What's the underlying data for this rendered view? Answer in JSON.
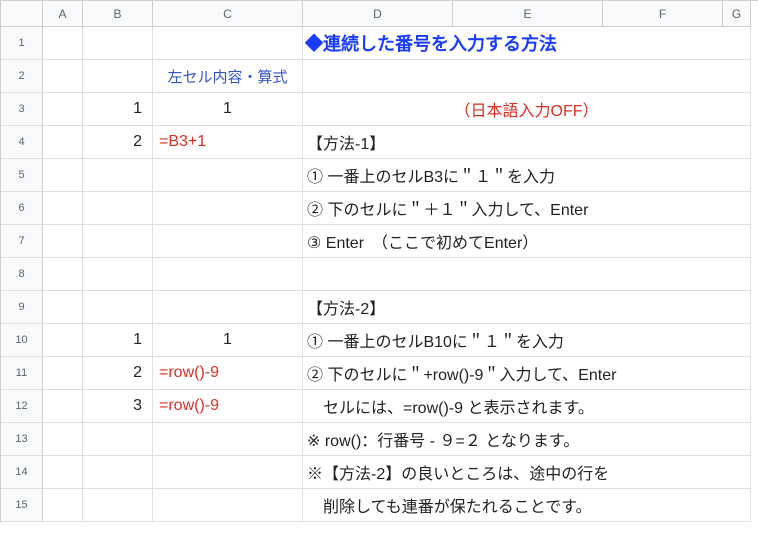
{
  "columns": {
    "A": "A",
    "B": "B",
    "C": "C",
    "D": "D",
    "E": "E",
    "F": "F",
    "G": "G"
  },
  "rows": [
    "1",
    "2",
    "3",
    "4",
    "5",
    "6",
    "7",
    "8",
    "9",
    "10",
    "11",
    "12",
    "13",
    "14",
    "15"
  ],
  "title": "◆連続した番号を入力する方法",
  "c2": "左セル内容・算式",
  "b3": "1",
  "c3": "1",
  "d3": "（日本語入力OFF）",
  "b4": "2",
  "c4": "=B3+1",
  "d4": "【方法-1】",
  "d5": "① 一番上のセルB3に＂１＂を入力",
  "d6": "② 下のセルに＂＋１＂入力して、Enter",
  "d7": "③ Enter　（ここで初めてEnter）",
  "d9": "【方法-2】",
  "b10": "1",
  "c10": "1",
  "d10": "① 一番上のセルB10に＂１＂を入力",
  "b11": "2",
  "c11": "=row()-9",
  "d11": "② 下のセルに＂+row()-9＂入力して、Enter",
  "b12": "3",
  "c12": "=row()-9",
  "d12": "　セルには、=row()-9 と表示されます。",
  "d13": "※ row()：行番号 - ９=２ となります。",
  "d14": "※【方法-2】の良いところは、途中の行を",
  "d15": "　削除しても連番が保たれることです。",
  "chart_data": {
    "type": "table",
    "title": "連続した番号を入力する方法",
    "columns": [
      "row",
      "B",
      "C",
      "D"
    ],
    "rows": [
      {
        "row": 2,
        "B": "",
        "C": "左セル内容・算式",
        "D": ""
      },
      {
        "row": 3,
        "B": 1,
        "C": 1,
        "D": "（日本語入力OFF）"
      },
      {
        "row": 4,
        "B": 2,
        "C": "=B3+1",
        "D": "【方法-1】"
      },
      {
        "row": 5,
        "B": "",
        "C": "",
        "D": "① 一番上のセルB3に\"1\"を入力"
      },
      {
        "row": 6,
        "B": "",
        "C": "",
        "D": "② 下のセルに\"+1\"入力して、Enter"
      },
      {
        "row": 7,
        "B": "",
        "C": "",
        "D": "③ Enter （ここで初めてEnter）"
      },
      {
        "row": 9,
        "B": "",
        "C": "",
        "D": "【方法-2】"
      },
      {
        "row": 10,
        "B": 1,
        "C": 1,
        "D": "① 一番上のセルB10に\"1\"を入力"
      },
      {
        "row": 11,
        "B": 2,
        "C": "=row()-9",
        "D": "② 下のセルに\"+row()-9\"入力して、Enter"
      },
      {
        "row": 12,
        "B": 3,
        "C": "=row()-9",
        "D": "セルには、=row()-9 と表示されます。"
      },
      {
        "row": 13,
        "B": "",
        "C": "",
        "D": "※ row()：行番号 - 9=2 となります。"
      },
      {
        "row": 14,
        "B": "",
        "C": "",
        "D": "※【方法-2】の良いところは、途中の行を"
      },
      {
        "row": 15,
        "B": "",
        "C": "",
        "D": "削除しても連番が保たれることです。"
      }
    ]
  }
}
